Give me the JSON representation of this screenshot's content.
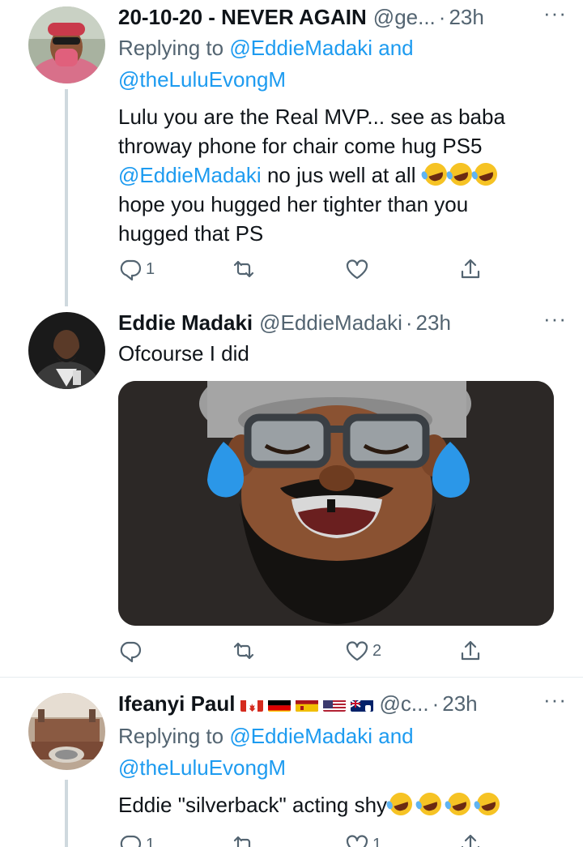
{
  "tweets": [
    {
      "name": "20-10-20 - NEVER AGAIN",
      "handle": "@ge...",
      "dot": "·",
      "time": "23h",
      "more": "···",
      "replying_prefix": "Replying to",
      "replying_user1": "@EddieMadaki",
      "replying_and": "and",
      "replying_user2": "@theLuluEvongM",
      "text_line1": "Lulu you are the Real MVP... see as baba",
      "text_line2": "throway phone for chair come hug PS5",
      "text_mention": "@EddieMadaki",
      "text_line3_rest": "no jus well at all",
      "text_line4": "hope you hugged her tighter than you",
      "text_line5": "hugged that PS",
      "reply_count": "1",
      "retweet_count": "",
      "like_count": ""
    },
    {
      "name": "Eddie Madaki",
      "handle": "@EddieMadaki",
      "dot": "·",
      "time": "23h",
      "more": "···",
      "text": "Ofcourse I did",
      "reply_count": "",
      "retweet_count": "",
      "like_count": "2"
    },
    {
      "name": "Ifeanyi Paul",
      "handle": "@c...",
      "dot": "·",
      "time": "23h",
      "more": "···",
      "replying_prefix": "Replying to",
      "replying_user1": "@EddieMadaki",
      "replying_and": "and",
      "replying_user2": "@theLuluEvongM",
      "text": "Eddie \"silverback\" acting shy",
      "reply_count": "1",
      "retweet_count": "",
      "like_count": "1"
    }
  ],
  "colors": {
    "link": "#1d9bf0",
    "secondary_text": "#536471",
    "primary_text": "#0f1419",
    "thread_line": "#cfd9de",
    "media_bg": "#2c2826"
  },
  "icons": [
    "reply-icon",
    "retweet-icon",
    "like-icon",
    "share-icon",
    "more-icon",
    "rofl-emoji"
  ]
}
